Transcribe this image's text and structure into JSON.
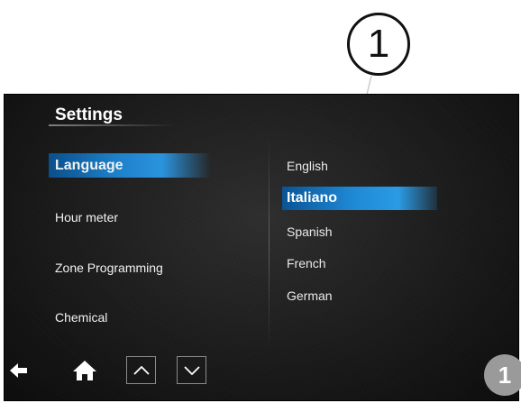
{
  "callout": {
    "number": "1"
  },
  "settings": {
    "title": "Settings",
    "menu": [
      {
        "label": "Language",
        "selected": true
      },
      {
        "label": "Hour meter",
        "selected": false
      },
      {
        "label": "Zone Programming",
        "selected": false
      },
      {
        "label": "Chemical",
        "selected": false
      }
    ],
    "languages": [
      {
        "label": "English",
        "selected": false
      },
      {
        "label": "Italiano",
        "selected": true
      },
      {
        "label": "Spanish",
        "selected": false
      },
      {
        "label": "French",
        "selected": false
      },
      {
        "label": "German",
        "selected": false
      }
    ]
  },
  "nav": {
    "icons": [
      "back-arrow-icon",
      "home-icon",
      "chevron-up-icon",
      "chevron-down-icon"
    ]
  },
  "badge": {
    "number": "1"
  },
  "colors": {
    "highlight": "#1d7fc8",
    "screen_background": "#151515",
    "badge": "#9a9a9a"
  }
}
